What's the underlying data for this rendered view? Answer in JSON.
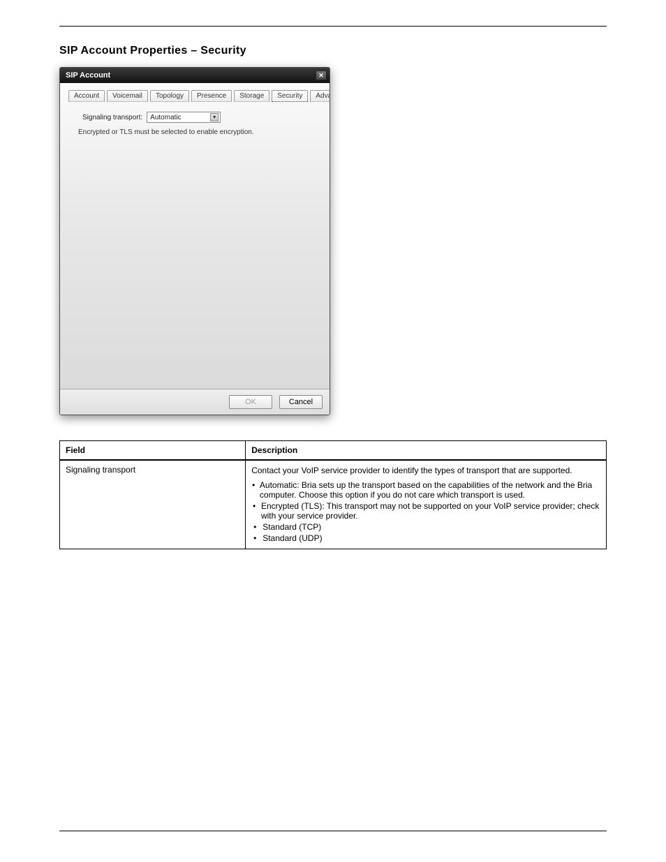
{
  "header": {
    "left": "",
    "right": ""
  },
  "footer": {
    "left": "",
    "page": ""
  },
  "section_title": "SIP Account Properties – Security",
  "dialog": {
    "title": "SIP Account",
    "close_label": "✕",
    "tabs": {
      "account": "Account",
      "voicemail": "Voicemail",
      "topology": "Topology",
      "presence": "Presence",
      "storage": "Storage",
      "security": "Security",
      "advanced": "Advanced"
    },
    "fields": {
      "signaling_label": "Signaling transport:",
      "signaling_value": "Automatic",
      "info_text": "Encrypted or TLS must be selected to enable encryption."
    },
    "buttons": {
      "ok": "OK",
      "cancel": "Cancel"
    }
  },
  "table": {
    "head_field": "Field",
    "head_desc": "Description",
    "row_field": "Signaling transport",
    "row_desc": {
      "p1": "Contact your VoIP service provider to identify the types of transport that are supported.",
      "b1": "Automatic: Bria sets up the transport based on the capabilities of the network and the Bria computer. Choose this option if you do not care which transport is used.",
      "b2": "Encrypted (TLS): This transport may not be supported on your VoIP service provider; check with your service provider.",
      "b3": "Standard (TCP)",
      "b4": "Standard (UDP)"
    }
  }
}
